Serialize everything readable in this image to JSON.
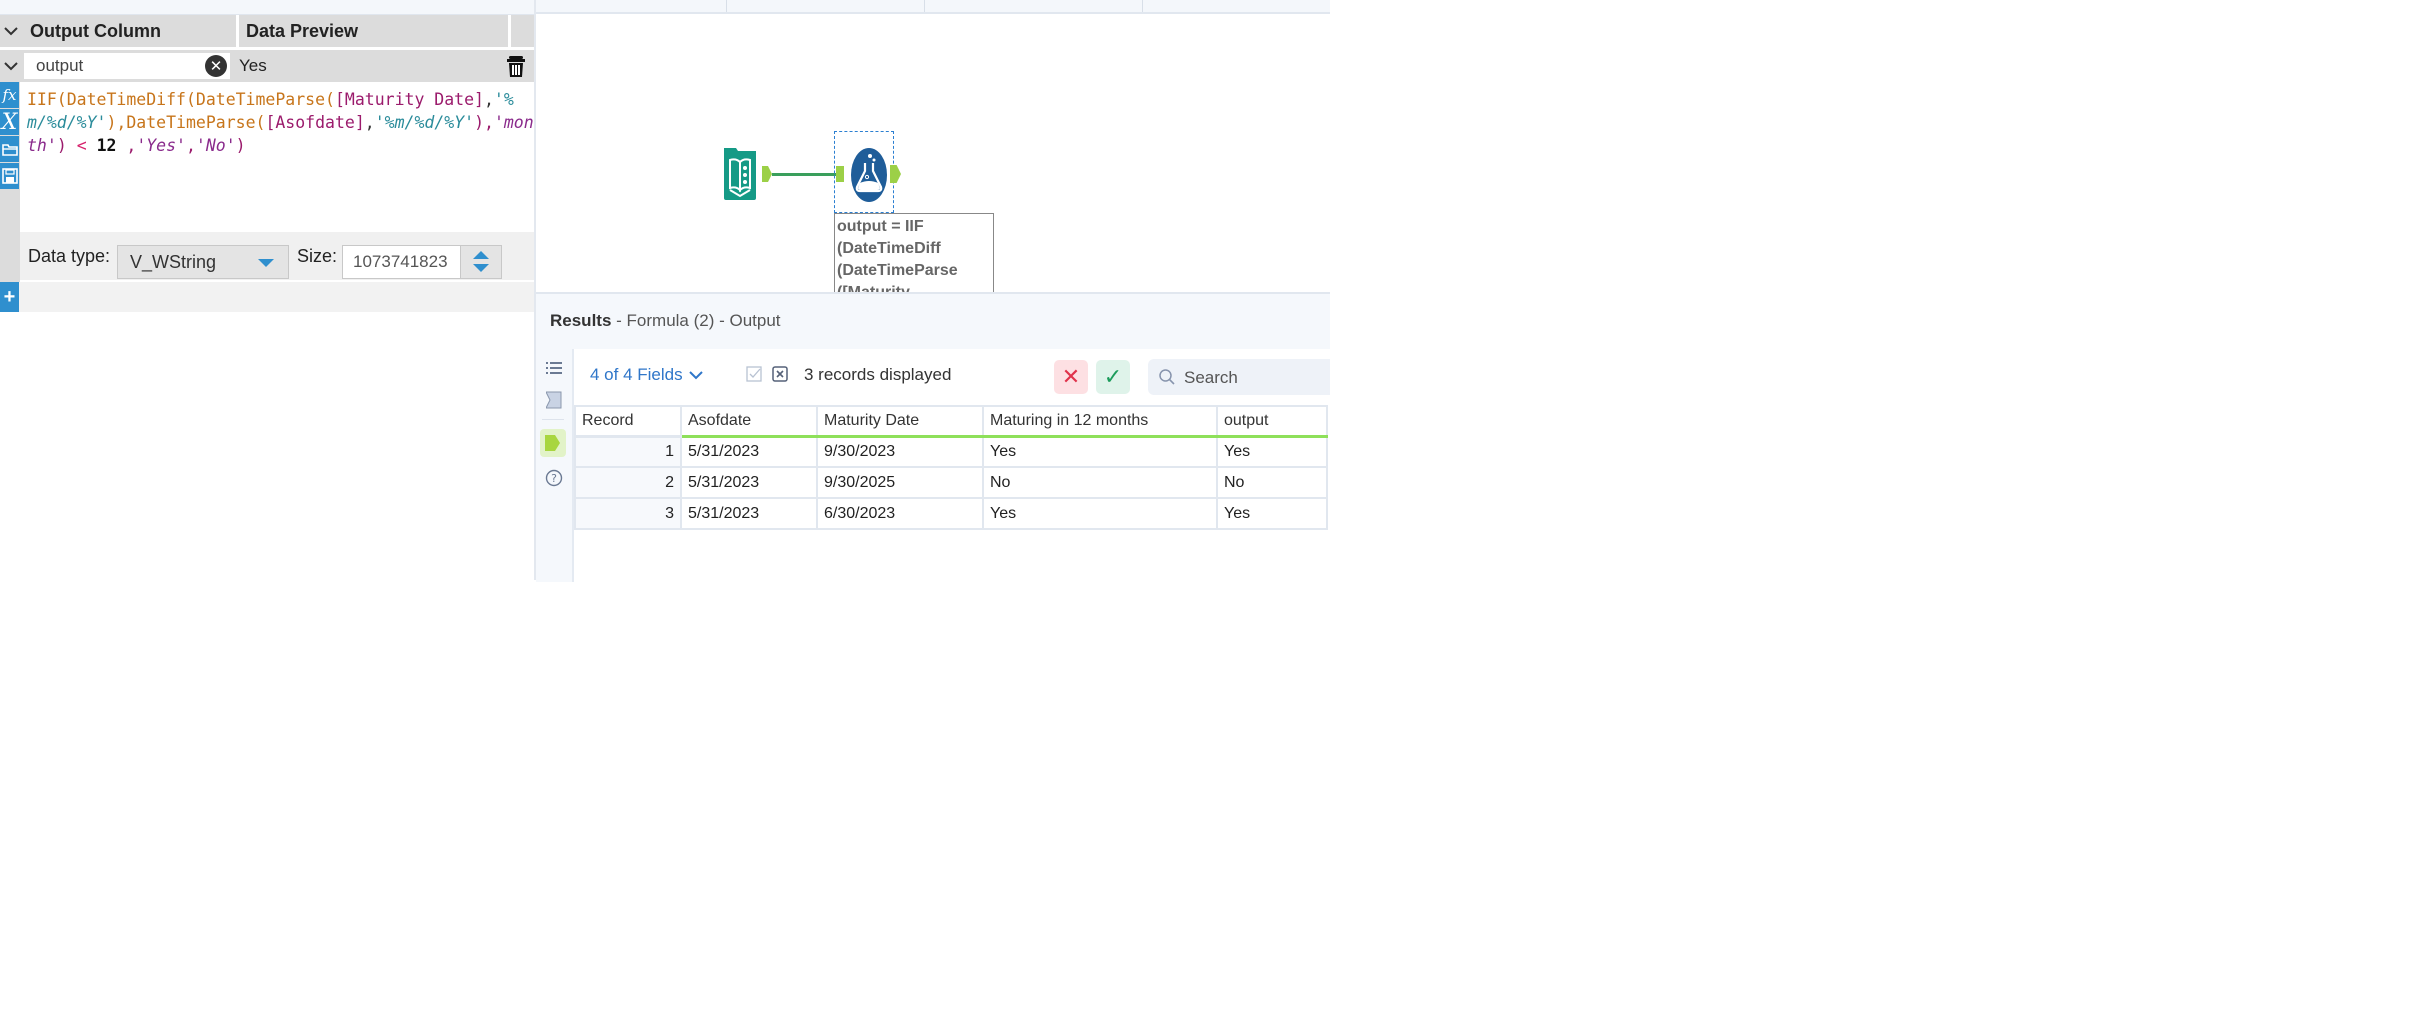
{
  "formula_panel": {
    "header": {
      "output_column": "Output Column",
      "data_preview": "Data Preview"
    },
    "row": {
      "output_name": "output",
      "preview_value": "Yes"
    },
    "expression_tokens": [
      {
        "t": "IIF(",
        "c": "fn"
      },
      {
        "t": "DateTimeDiff(",
        "c": "fn"
      },
      {
        "t": "DateTimeParse(",
        "c": "fn"
      },
      {
        "t": "[Maturity Date]",
        "c": "field"
      },
      {
        "t": ",",
        "c": "p"
      },
      {
        "t": "'%m/%d/%Y'",
        "c": "str"
      },
      {
        "t": "),",
        "c": "fn"
      },
      {
        "t": "DateTimeParse(",
        "c": "fn"
      },
      {
        "t": "[Asofdate]",
        "c": "field"
      },
      {
        "t": ",",
        "c": "p"
      },
      {
        "t": "'%m/%d/%Y'",
        "c": "str"
      },
      {
        "t": "),",
        "c": "field"
      },
      {
        "t": "'month'",
        "c": "str2"
      },
      {
        "t": ") ",
        "c": "field"
      },
      {
        "t": "<",
        "c": "op"
      },
      {
        "t": " ",
        "c": "p"
      },
      {
        "t": "12",
        "c": "num"
      },
      {
        "t": " ,",
        "c": "field"
      },
      {
        "t": "'Yes'",
        "c": "str2"
      },
      {
        "t": ",",
        "c": "field"
      },
      {
        "t": "'No'",
        "c": "str2"
      },
      {
        "t": ")",
        "c": "field"
      }
    ],
    "data_type_label": "Data type:",
    "data_type_value": "V_WString",
    "size_label": "Size:",
    "size_value": "1073741823",
    "tools": [
      "function-icon",
      "variable-icon",
      "open-folder-icon",
      "save-icon"
    ]
  },
  "canvas": {
    "nodes": [
      {
        "name": "Input Data",
        "icon": "input-book-icon",
        "color": "#159a86"
      },
      {
        "name": "Formula (2)",
        "icon": "formula-flask-icon",
        "color": "#1f5d99"
      }
    ],
    "annotation_lines": [
      "output = IIF",
      "(DateTimeDiff",
      "(DateTimeParse",
      "([Maturity"
    ]
  },
  "results": {
    "title": "Results",
    "subtitle": " - Formula (2) - Output",
    "fields_selector": "4 of 4 Fields",
    "records_displayed": "3 records displayed",
    "search_placeholder": "Search",
    "columns": [
      "Record",
      "Asofdate",
      "Maturity Date",
      "Maturing in 12 months",
      "output"
    ],
    "rows": [
      [
        "1",
        "5/31/2023",
        "9/30/2023",
        "Yes",
        "Yes"
      ],
      [
        "2",
        "5/31/2023",
        "9/30/2025",
        "No",
        "No"
      ],
      [
        "3",
        "5/31/2023",
        "6/30/2023",
        "Yes",
        "Yes"
      ]
    ],
    "accent_color": "#8ee05a"
  }
}
